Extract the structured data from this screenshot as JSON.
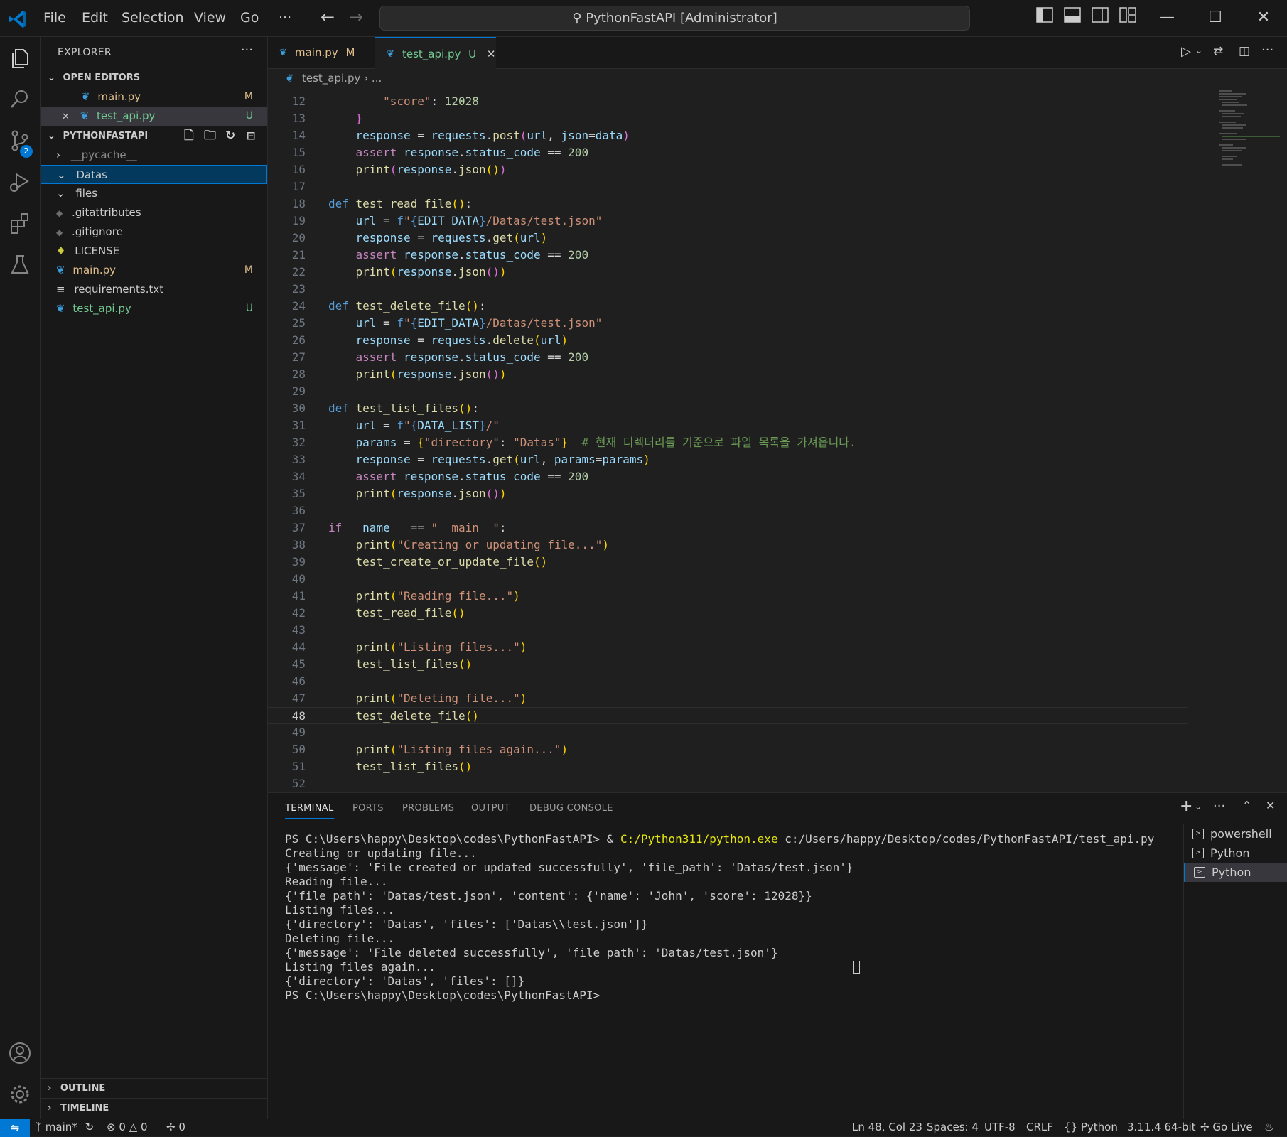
{
  "titlebar": {
    "menus": [
      "File",
      "Edit",
      "Selection",
      "View",
      "Go",
      "···"
    ],
    "command_center": "PythonFastAPI [Administrator]"
  },
  "activity_bar": {
    "scm_badge": "2"
  },
  "sidebar": {
    "title": "EXPLORER",
    "open_editors_label": "OPEN EDITORS",
    "open_editors": [
      {
        "name": "main.py",
        "badge": "M"
      },
      {
        "name": "test_api.py",
        "badge": "U"
      }
    ],
    "project_label": "PYTHONFASTAPI",
    "tree": [
      {
        "name": "__pycache__",
        "badge": ""
      },
      {
        "name": "Datas",
        "badge": ""
      },
      {
        "name": "files",
        "badge": ""
      },
      {
        "name": ".gitattributes",
        "badge": ""
      },
      {
        "name": ".gitignore",
        "badge": ""
      },
      {
        "name": "LICENSE",
        "badge": ""
      },
      {
        "name": "main.py",
        "badge": "M"
      },
      {
        "name": "requirements.txt",
        "badge": ""
      },
      {
        "name": "test_api.py",
        "badge": "U"
      }
    ],
    "outline_label": "OUTLINE",
    "timeline_label": "TIMELINE"
  },
  "tabs": [
    {
      "name": "main.py",
      "badge": "M"
    },
    {
      "name": "test_api.py",
      "badge": "U"
    }
  ],
  "breadcrumb": {
    "file": "test_api.py",
    "rest": "..."
  },
  "editor": {
    "current_line": "48",
    "lines": [
      {
        "n": "12",
        "segs": [
          [
            "pl",
            "        "
          ],
          [
            "st",
            "\"score\""
          ],
          [
            "pl",
            ": "
          ],
          [
            "nm",
            "12028"
          ]
        ]
      },
      {
        "n": "13",
        "segs": [
          [
            "pl",
            "    "
          ],
          [
            "br2",
            "}"
          ]
        ]
      },
      {
        "n": "14",
        "segs": [
          [
            "pl",
            "    "
          ],
          [
            "vr",
            "response"
          ],
          [
            "pl",
            " = "
          ],
          [
            "vr",
            "requests"
          ],
          [
            "pl",
            "."
          ],
          [
            "fn",
            "post"
          ],
          [
            "br2",
            "("
          ],
          [
            "vr",
            "url"
          ],
          [
            "pl",
            ", "
          ],
          [
            "vr",
            "json"
          ],
          [
            "pl",
            "="
          ],
          [
            "vr",
            "data"
          ],
          [
            "br2",
            ")"
          ]
        ]
      },
      {
        "n": "15",
        "segs": [
          [
            "pl",
            "    "
          ],
          [
            "cf",
            "assert"
          ],
          [
            "pl",
            " "
          ],
          [
            "vr",
            "response"
          ],
          [
            "pl",
            "."
          ],
          [
            "vr",
            "status_code"
          ],
          [
            "pl",
            " == "
          ],
          [
            "nm",
            "200"
          ]
        ]
      },
      {
        "n": "16",
        "segs": [
          [
            "pl",
            "    "
          ],
          [
            "fn",
            "print"
          ],
          [
            "br2",
            "("
          ],
          [
            "vr",
            "response"
          ],
          [
            "pl",
            "."
          ],
          [
            "fn",
            "json"
          ],
          [
            "br",
            "()"
          ],
          [
            "br2",
            ")"
          ]
        ]
      },
      {
        "n": "17",
        "segs": []
      },
      {
        "n": "18",
        "segs": [
          [
            "kw",
            "def"
          ],
          [
            "pl",
            " "
          ],
          [
            "fn",
            "test_read_file"
          ],
          [
            "br",
            "()"
          ],
          [
            "pl",
            ":"
          ]
        ]
      },
      {
        "n": "19",
        "segs": [
          [
            "pl",
            "    "
          ],
          [
            "vr",
            "url"
          ],
          [
            "pl",
            " = "
          ],
          [
            "kw",
            "f"
          ],
          [
            "st",
            "\""
          ],
          [
            "kw",
            "{"
          ],
          [
            "vr",
            "EDIT_DATA"
          ],
          [
            "kw",
            "}"
          ],
          [
            "st",
            "/Datas/test.json\""
          ]
        ]
      },
      {
        "n": "20",
        "segs": [
          [
            "pl",
            "    "
          ],
          [
            "vr",
            "response"
          ],
          [
            "pl",
            " = "
          ],
          [
            "vr",
            "requests"
          ],
          [
            "pl",
            "."
          ],
          [
            "fn",
            "get"
          ],
          [
            "br",
            "("
          ],
          [
            "vr",
            "url"
          ],
          [
            "br",
            ")"
          ]
        ]
      },
      {
        "n": "21",
        "segs": [
          [
            "pl",
            "    "
          ],
          [
            "cf",
            "assert"
          ],
          [
            "pl",
            " "
          ],
          [
            "vr",
            "response"
          ],
          [
            "pl",
            "."
          ],
          [
            "vr",
            "status_code"
          ],
          [
            "pl",
            " == "
          ],
          [
            "nm",
            "200"
          ]
        ]
      },
      {
        "n": "22",
        "segs": [
          [
            "pl",
            "    "
          ],
          [
            "fn",
            "print"
          ],
          [
            "br",
            "("
          ],
          [
            "vr",
            "response"
          ],
          [
            "pl",
            "."
          ],
          [
            "fn",
            "json"
          ],
          [
            "br2",
            "()"
          ],
          [
            "br",
            ")"
          ]
        ]
      },
      {
        "n": "23",
        "segs": []
      },
      {
        "n": "24",
        "segs": [
          [
            "kw",
            "def"
          ],
          [
            "pl",
            " "
          ],
          [
            "fn",
            "test_delete_file"
          ],
          [
            "br",
            "()"
          ],
          [
            "pl",
            ":"
          ]
        ]
      },
      {
        "n": "25",
        "segs": [
          [
            "pl",
            "    "
          ],
          [
            "vr",
            "url"
          ],
          [
            "pl",
            " = "
          ],
          [
            "kw",
            "f"
          ],
          [
            "st",
            "\""
          ],
          [
            "kw",
            "{"
          ],
          [
            "vr",
            "EDIT_DATA"
          ],
          [
            "kw",
            "}"
          ],
          [
            "st",
            "/Datas/test.json\""
          ]
        ]
      },
      {
        "n": "26",
        "segs": [
          [
            "pl",
            "    "
          ],
          [
            "vr",
            "response"
          ],
          [
            "pl",
            " = "
          ],
          [
            "vr",
            "requests"
          ],
          [
            "pl",
            "."
          ],
          [
            "fn",
            "delete"
          ],
          [
            "br",
            "("
          ],
          [
            "vr",
            "url"
          ],
          [
            "br",
            ")"
          ]
        ]
      },
      {
        "n": "27",
        "segs": [
          [
            "pl",
            "    "
          ],
          [
            "cf",
            "assert"
          ],
          [
            "pl",
            " "
          ],
          [
            "vr",
            "response"
          ],
          [
            "pl",
            "."
          ],
          [
            "vr",
            "status_code"
          ],
          [
            "pl",
            " == "
          ],
          [
            "nm",
            "200"
          ]
        ]
      },
      {
        "n": "28",
        "segs": [
          [
            "pl",
            "    "
          ],
          [
            "fn",
            "print"
          ],
          [
            "br",
            "("
          ],
          [
            "vr",
            "response"
          ],
          [
            "pl",
            "."
          ],
          [
            "fn",
            "json"
          ],
          [
            "br2",
            "()"
          ],
          [
            "br",
            ")"
          ]
        ]
      },
      {
        "n": "29",
        "segs": []
      },
      {
        "n": "30",
        "segs": [
          [
            "kw",
            "def"
          ],
          [
            "pl",
            " "
          ],
          [
            "fn",
            "test_list_files"
          ],
          [
            "br",
            "()"
          ],
          [
            "pl",
            ":"
          ]
        ]
      },
      {
        "n": "31",
        "segs": [
          [
            "pl",
            "    "
          ],
          [
            "vr",
            "url"
          ],
          [
            "pl",
            " = "
          ],
          [
            "kw",
            "f"
          ],
          [
            "st",
            "\""
          ],
          [
            "kw",
            "{"
          ],
          [
            "vr",
            "DATA_LIST"
          ],
          [
            "kw",
            "}"
          ],
          [
            "st",
            "/\""
          ]
        ]
      },
      {
        "n": "32",
        "segs": [
          [
            "pl",
            "    "
          ],
          [
            "vr",
            "params"
          ],
          [
            "pl",
            " = "
          ],
          [
            "br",
            "{"
          ],
          [
            "st",
            "\"directory\""
          ],
          [
            "pl",
            ": "
          ],
          [
            "st",
            "\"Datas\""
          ],
          [
            "br",
            "}"
          ],
          [
            "pl",
            "  "
          ],
          [
            "cm",
            "# 현재 디렉터리를 기준으로 파일 목록을 가져옵니다."
          ]
        ]
      },
      {
        "n": "33",
        "segs": [
          [
            "pl",
            "    "
          ],
          [
            "vr",
            "response"
          ],
          [
            "pl",
            " = "
          ],
          [
            "vr",
            "requests"
          ],
          [
            "pl",
            "."
          ],
          [
            "fn",
            "get"
          ],
          [
            "br",
            "("
          ],
          [
            "vr",
            "url"
          ],
          [
            "pl",
            ", "
          ],
          [
            "vr",
            "params"
          ],
          [
            "pl",
            "="
          ],
          [
            "vr",
            "params"
          ],
          [
            "br",
            ")"
          ]
        ]
      },
      {
        "n": "34",
        "segs": [
          [
            "pl",
            "    "
          ],
          [
            "cf",
            "assert"
          ],
          [
            "pl",
            " "
          ],
          [
            "vr",
            "response"
          ],
          [
            "pl",
            "."
          ],
          [
            "vr",
            "status_code"
          ],
          [
            "pl",
            " == "
          ],
          [
            "nm",
            "200"
          ]
        ]
      },
      {
        "n": "35",
        "segs": [
          [
            "pl",
            "    "
          ],
          [
            "fn",
            "print"
          ],
          [
            "br",
            "("
          ],
          [
            "vr",
            "response"
          ],
          [
            "pl",
            "."
          ],
          [
            "fn",
            "json"
          ],
          [
            "br2",
            "()"
          ],
          [
            "br",
            ")"
          ]
        ]
      },
      {
        "n": "36",
        "segs": []
      },
      {
        "n": "37",
        "segs": [
          [
            "cf",
            "if"
          ],
          [
            "pl",
            " "
          ],
          [
            "vr",
            "__name__"
          ],
          [
            "pl",
            " == "
          ],
          [
            "st",
            "\"__main__\""
          ],
          [
            "pl",
            ":"
          ]
        ]
      },
      {
        "n": "38",
        "segs": [
          [
            "pl",
            "    "
          ],
          [
            "fn",
            "print"
          ],
          [
            "br",
            "("
          ],
          [
            "st",
            "\"Creating or updating file...\""
          ],
          [
            "br",
            ")"
          ]
        ]
      },
      {
        "n": "39",
        "segs": [
          [
            "pl",
            "    "
          ],
          [
            "fn",
            "test_create_or_update_file"
          ],
          [
            "br",
            "()"
          ]
        ]
      },
      {
        "n": "40",
        "segs": []
      },
      {
        "n": "41",
        "segs": [
          [
            "pl",
            "    "
          ],
          [
            "fn",
            "print"
          ],
          [
            "br",
            "("
          ],
          [
            "st",
            "\"Reading file...\""
          ],
          [
            "br",
            ")"
          ]
        ]
      },
      {
        "n": "42",
        "segs": [
          [
            "pl",
            "    "
          ],
          [
            "fn",
            "test_read_file"
          ],
          [
            "br",
            "()"
          ]
        ]
      },
      {
        "n": "43",
        "segs": []
      },
      {
        "n": "44",
        "segs": [
          [
            "pl",
            "    "
          ],
          [
            "fn",
            "print"
          ],
          [
            "br",
            "("
          ],
          [
            "st",
            "\"Listing files...\""
          ],
          [
            "br",
            ")"
          ]
        ]
      },
      {
        "n": "45",
        "segs": [
          [
            "pl",
            "    "
          ],
          [
            "fn",
            "test_list_files"
          ],
          [
            "br",
            "()"
          ]
        ]
      },
      {
        "n": "46",
        "segs": []
      },
      {
        "n": "47",
        "segs": [
          [
            "pl",
            "    "
          ],
          [
            "fn",
            "print"
          ],
          [
            "br",
            "("
          ],
          [
            "st",
            "\"Deleting file...\""
          ],
          [
            "br",
            ")"
          ]
        ]
      },
      {
        "n": "48",
        "segs": [
          [
            "pl",
            "    "
          ],
          [
            "fn",
            "test_delete_file"
          ],
          [
            "br",
            "()"
          ]
        ]
      },
      {
        "n": "49",
        "segs": []
      },
      {
        "n": "50",
        "segs": [
          [
            "pl",
            "    "
          ],
          [
            "fn",
            "print"
          ],
          [
            "br",
            "("
          ],
          [
            "st",
            "\"Listing files again...\""
          ],
          [
            "br",
            ")"
          ]
        ]
      },
      {
        "n": "51",
        "segs": [
          [
            "pl",
            "    "
          ],
          [
            "fn",
            "test_list_files"
          ],
          [
            "br",
            "()"
          ]
        ]
      },
      {
        "n": "52",
        "segs": []
      }
    ]
  },
  "panel": {
    "tabs": [
      "TERMINAL",
      "PORTS",
      "PROBLEMS",
      "OUTPUT",
      "DEBUG CONSOLE"
    ],
    "terminal_lines": [
      {
        "prefix": "PS C:\\Users\\happy\\Desktop\\codes\\PythonFastAPI> & ",
        "hl": "C:/Python311/python.exe",
        "suffix": " c:/Users/happy/Desktop/codes/PythonFastAPI/test_api.py"
      },
      {
        "prefix": "Creating or updating file...",
        "hl": "",
        "suffix": ""
      },
      {
        "prefix": "{'message': 'File created or updated successfully', 'file_path': 'Datas/test.json'}",
        "hl": "",
        "suffix": ""
      },
      {
        "prefix": "Reading file...",
        "hl": "",
        "suffix": ""
      },
      {
        "prefix": "{'file_path': 'Datas/test.json', 'content': {'name': 'John', 'score': 12028}}",
        "hl": "",
        "suffix": ""
      },
      {
        "prefix": "Listing files...",
        "hl": "",
        "suffix": ""
      },
      {
        "prefix": "{'directory': 'Datas', 'files': ['Datas\\\\test.json']}",
        "hl": "",
        "suffix": ""
      },
      {
        "prefix": "Deleting file...",
        "hl": "",
        "suffix": ""
      },
      {
        "prefix": "{'message': 'File deleted successfully', 'file_path': 'Datas/test.json'}",
        "hl": "",
        "suffix": ""
      },
      {
        "prefix": "Listing files again...",
        "hl": "",
        "suffix": ""
      },
      {
        "prefix": "{'directory': 'Datas', 'files': []}",
        "hl": "",
        "suffix": ""
      },
      {
        "prefix": "PS C:\\Users\\happy\\Desktop\\codes\\PythonFastAPI>",
        "hl": "",
        "suffix": ""
      }
    ],
    "terminal_instances": [
      "powershell",
      "Python",
      "Python"
    ]
  },
  "statusbar": {
    "branch": "main*",
    "errors": "0",
    "warnings": "0",
    "ports": "0",
    "position": "Ln 48, Col 23",
    "spaces": "Spaces: 4",
    "encoding": "UTF-8",
    "eol": "CRLF",
    "language": "Python",
    "interpreter": "3.11.4 64-bit",
    "golive": "Go Live"
  },
  "colors": {
    "accent": "#0078d4",
    "modified": "#e2c08d",
    "untracked": "#73c991"
  }
}
